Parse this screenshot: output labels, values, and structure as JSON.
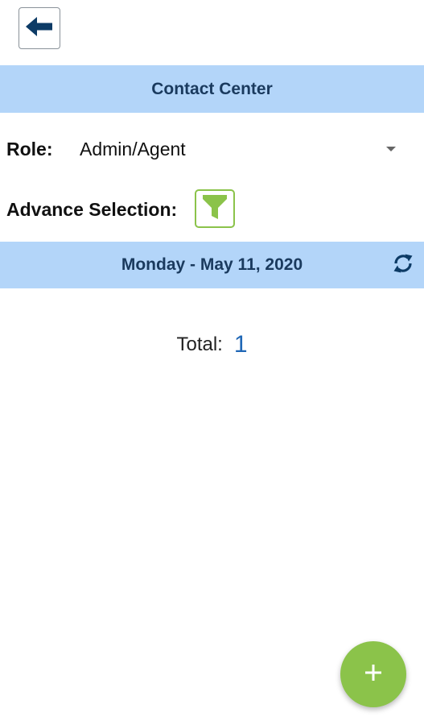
{
  "header": {
    "back_icon": "arrow-left-icon",
    "title": "Contact Center"
  },
  "role": {
    "label": "Role:",
    "selected_value": "Admin/Agent",
    "dropdown_icon": "caret-down-icon"
  },
  "advance_selection": {
    "label": "Advance Selection:",
    "filter_icon": "funnel-filter-icon"
  },
  "date_bar": {
    "date": "Monday - May 11, 2020",
    "refresh_icon": "refresh-icon"
  },
  "total": {
    "label": "Total:",
    "value": "1"
  },
  "fab": {
    "icon": "plus-icon"
  },
  "colors": {
    "bar_background": "#b3d5f9",
    "bar_text": "#1a3a5e",
    "accent_green": "#8bc34a",
    "total_value": "#1f67b6"
  }
}
